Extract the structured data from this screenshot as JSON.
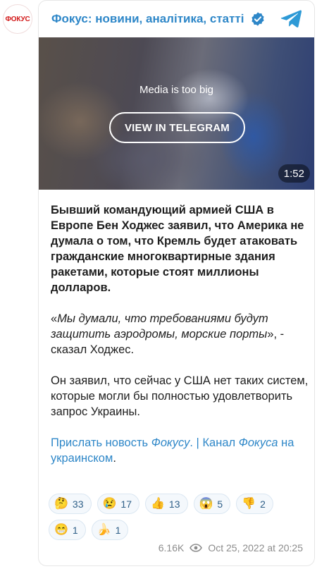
{
  "avatar": {
    "label": "ФОКУС"
  },
  "header": {
    "channel_title": "Фокус: новини, аналітика, статті"
  },
  "media": {
    "status_text": "Media is too big",
    "view_button": "VIEW IN TELEGRAM",
    "duration": "1:52"
  },
  "post": {
    "lead": "Бывший командующий армией США в Европе Бен Ходжес заявил, что Америка не думала о том, что Кремль будет атаковать гражданские многоквартирные здания ракетами, которые стоят миллионы долларов.",
    "quote_open": "«",
    "quote_text": "Мы думали, что требованиями будут защитить аэродромы, морские порты",
    "quote_close": "», - сказал Ходжес.",
    "paragraph3": "Он заявил, что сейчас у США нет таких систем, которые могли бы полностью удовлетворить запрос Украины.",
    "links": {
      "send_news_prefix": "Прислать новость ",
      "send_news_em": "Фокусу",
      "send_news_suffix": ".",
      "separator": " | ",
      "channel_prefix": "Канал ",
      "channel_em": "Фокуса",
      "channel_suffix": " на украинском",
      "trailing": "."
    }
  },
  "reactions": [
    {
      "emoji": "🤔",
      "count": "33"
    },
    {
      "emoji": "😢",
      "count": "17"
    },
    {
      "emoji": "👍",
      "count": "13"
    },
    {
      "emoji": "😱",
      "count": "5"
    },
    {
      "emoji": "👎",
      "count": "2"
    },
    {
      "emoji": "😁",
      "count": "1"
    },
    {
      "emoji": "🍌",
      "count": "1"
    }
  ],
  "footer": {
    "views": "6.16K",
    "timestamp": "Oct 25, 2022 at 20:25"
  },
  "colors": {
    "link": "#2e87c8",
    "brand_red": "#d21a1a"
  },
  "icons": [
    "verified-icon",
    "telegram-icon",
    "eye-icon"
  ]
}
